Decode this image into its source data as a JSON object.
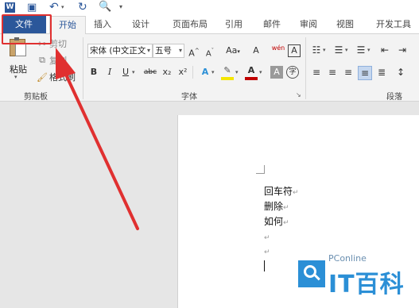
{
  "quick_access": {
    "icons": [
      "word-icon",
      "save-icon",
      "undo-icon",
      "redo-icon",
      "print-preview-icon",
      "customize-qat-icon"
    ]
  },
  "tabs": {
    "file": "文件",
    "items": [
      "开始",
      "插入",
      "设计",
      "页面布局",
      "引用",
      "邮件",
      "审阅",
      "视图",
      "开发工具"
    ],
    "active": "开始"
  },
  "clipboard": {
    "paste": "粘贴",
    "cut": "剪切",
    "copy": "复制",
    "format_painter": "格式刷",
    "label": "剪贴板"
  },
  "font": {
    "family": "宋体 (中文正文",
    "size": "五号",
    "label": "字体",
    "bold": "B",
    "italic": "I",
    "underline": "U",
    "strike": "abc",
    "subscript": "x₂",
    "superscript": "x²",
    "grow": "A",
    "shrink": "A",
    "case": "Aa",
    "clear": "A",
    "phonetic": "wén",
    "border": "A",
    "highlight_color": "#f5e600",
    "font_color": "#c00000"
  },
  "paragraph": {
    "label": "段落"
  },
  "document": {
    "lines": [
      "回车符",
      "删除",
      "如何"
    ],
    "pilcrow": "↵"
  },
  "watermark": {
    "brand": "PConline",
    "big": "IT百科"
  },
  "colors": {
    "accent": "#2b579a",
    "annotation": "#e03030"
  }
}
